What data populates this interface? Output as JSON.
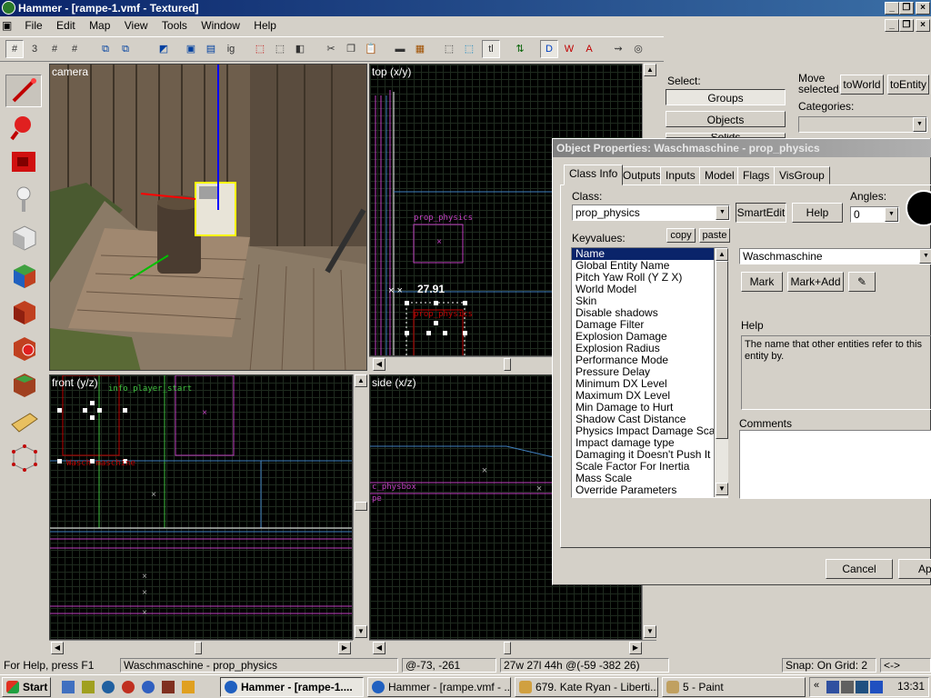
{
  "app": {
    "title": "Hammer - [rampe-1.vmf - Textured]"
  },
  "menu": [
    "File",
    "Edit",
    "Map",
    "View",
    "Tools",
    "Window",
    "Help"
  ],
  "views": {
    "camera": "camera",
    "top": "top (x/y)",
    "front": "front (y/z)",
    "side": "side (x/z)",
    "top_labels": [
      "prop_physics",
      "prop_physics"
    ],
    "top_dimension": "27.91",
    "front_labels": [
      "info_player_start",
      "Wasch maschine"
    ],
    "side_labels": [
      "c_physbox",
      "pe"
    ]
  },
  "right_panel": {
    "select_label": "Select:",
    "groups_btn": "Groups",
    "objects_btn": "Objects",
    "solids_btn": "Solids",
    "move_selected": "Move selected:",
    "toworld_btn": "toWorld",
    "toentity_btn": "toEntity",
    "categories_label": "Categories:"
  },
  "dialog": {
    "title": "Object Properties: Waschmaschine - prop_physics",
    "tabs": [
      "Class Info",
      "Outputs",
      "Inputs",
      "Model",
      "Flags",
      "VisGroup"
    ],
    "class_label": "Class:",
    "class_value": "prop_physics",
    "smartedit_btn": "SmartEdit",
    "help_btn": "Help",
    "angles_label": "Angles:",
    "angles_value": "0",
    "keyvalues_label": "Keyvalues:",
    "copy_btn": "copy",
    "paste_btn": "paste",
    "keyvalues": [
      "Name",
      "Global Entity Name",
      "Pitch Yaw Roll (Y Z X)",
      "World Model",
      "Skin",
      "Disable shadows",
      "Damage Filter",
      "Explosion Damage",
      "Explosion Radius",
      "Performance Mode",
      "Pressure Delay",
      "Minimum DX Level",
      "Maximum DX Level",
      "Min Damage to Hurt",
      "Shadow Cast Distance",
      "Physics Impact Damage Scale",
      "Impact damage type",
      "Damaging it Doesn't Push It",
      "Scale Factor For Inertia",
      "Mass Scale",
      "Override Parameters"
    ],
    "value_field": "Waschmaschine",
    "mark_btn": "Mark",
    "markadd_btn": "Mark+Add",
    "help_label": "Help",
    "help_text": "The name that other entities refer to this entity by.",
    "comments_label": "Comments",
    "cancel_btn": "Cancel",
    "apply_btn": "Apply"
  },
  "status": {
    "help": "For Help, press F1",
    "selection": "Waschmaschine - prop_physics",
    "coords": "@-73, -261",
    "size": "27w 27l 44h @(-59 -382 26)",
    "snap": "Snap: On Grid: 2",
    "extra": "<->"
  },
  "taskbar": {
    "start": "Start",
    "tasks": [
      "Hammer - [rampe-1....",
      "Hammer - [rampe.vmf - ...",
      "679. Kate Ryan - Liberti...",
      "5 - Paint"
    ],
    "clock": "13:31"
  }
}
